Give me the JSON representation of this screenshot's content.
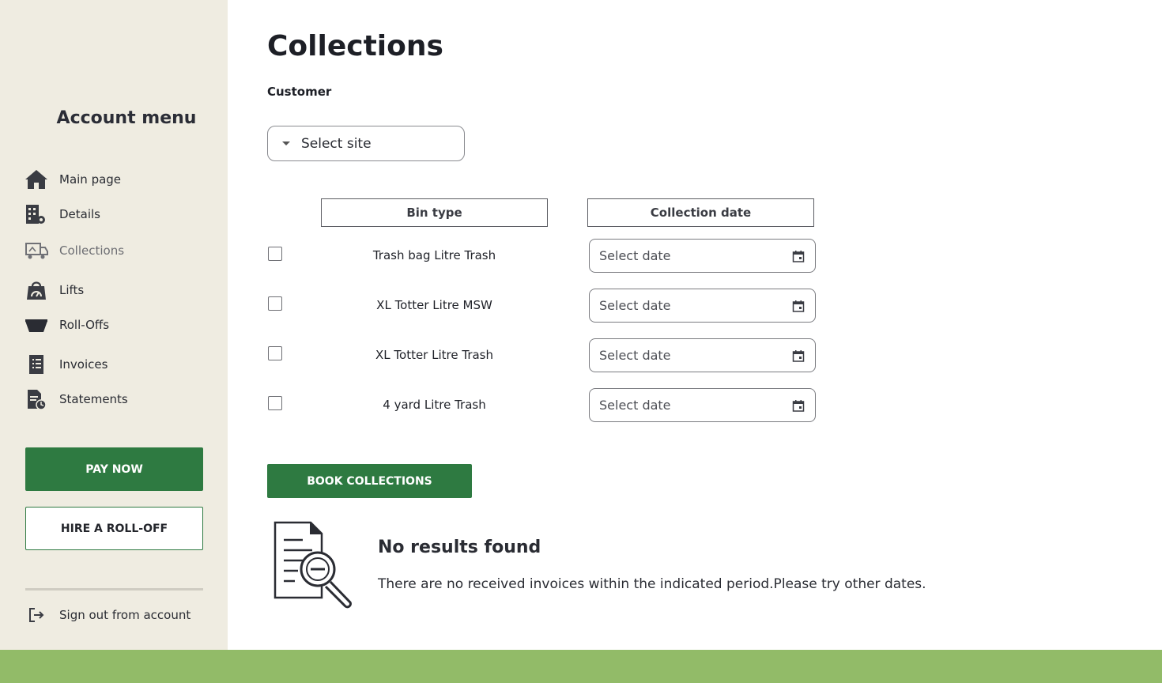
{
  "sidebar": {
    "title": "Account menu",
    "items": [
      {
        "label": "Main page",
        "icon": "home-icon"
      },
      {
        "label": "Details",
        "icon": "building-settings-icon"
      },
      {
        "label": "Collections",
        "icon": "truck-icon",
        "active": true
      },
      {
        "label": "Lifts",
        "icon": "bag-icon"
      },
      {
        "label": "Roll-Offs",
        "icon": "bin-icon"
      },
      {
        "label": "Invoices",
        "icon": "invoice-icon"
      },
      {
        "label": "Statements",
        "icon": "statement-icon"
      }
    ],
    "pay_now": "PAY NOW",
    "hire": "HIRE A ROLL-OFF",
    "sign_out": "Sign out from account"
  },
  "main": {
    "title": "Collections",
    "customer_label": "Customer",
    "site_select": "Select site",
    "columns": {
      "bin_type": "Bin type",
      "collection_date": "Collection date"
    },
    "rows": [
      {
        "bin": "Trash bag Litre Trash",
        "date_placeholder": "Select date",
        "checked": false
      },
      {
        "bin": "XL Totter Litre MSW",
        "date_placeholder": "Select date",
        "checked": false
      },
      {
        "bin": "XL Totter Litre Trash",
        "date_placeholder": "Select date",
        "checked": false
      },
      {
        "bin": "4 yard Litre Trash",
        "date_placeholder": "Select date",
        "checked": false
      }
    ],
    "book_button": "BOOK COLLECTIONS",
    "no_results": {
      "title": "No results found",
      "message": "There are no received invoices within the indicated period.Please try other dates."
    }
  },
  "colors": {
    "sidebar_bg": "#efece1",
    "primary_green": "#2e7a41",
    "footer_green": "#92bb68"
  }
}
